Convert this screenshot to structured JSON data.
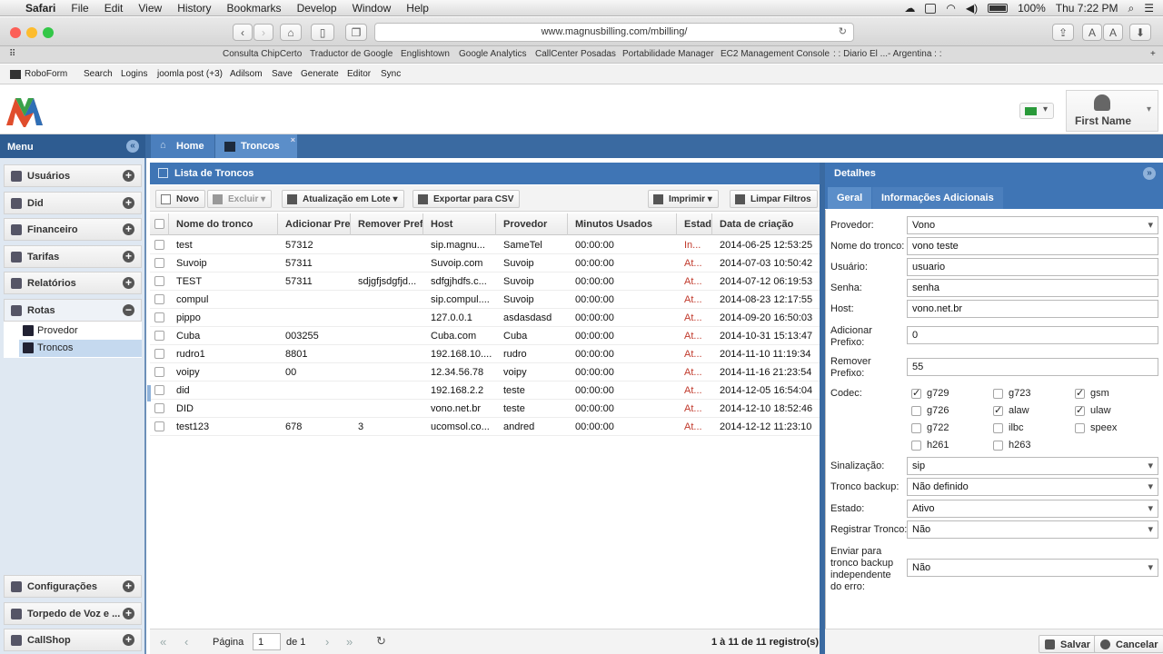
{
  "menubar": {
    "items": [
      "Safari",
      "File",
      "Edit",
      "View",
      "History",
      "Bookmarks",
      "Develop",
      "Window",
      "Help"
    ],
    "battery": "100%",
    "clock": "Thu 7:22 PM"
  },
  "browser": {
    "url": "www.magnusbilling.com/mbilling/",
    "bookmarks": [
      "Consulta ChipCerto",
      "Traductor de Google",
      "Englishtown",
      "Google Analytics",
      "CallCenter Posadas",
      "Portabilidade Manager",
      "EC2 Management Console",
      ": : Diario El ...- Argentina : :"
    ],
    "robobar": [
      "RoboForm",
      "Search",
      "Logins",
      "joomla post (+3)",
      "Adilsom",
      "Save",
      "Generate",
      "Editor",
      "Sync"
    ]
  },
  "header": {
    "user_name": "First Name"
  },
  "sidebar": {
    "title": "Menu",
    "items": [
      "Usuários",
      "Did",
      "Financeiro",
      "Tarifas",
      "Relatórios",
      "Rotas"
    ],
    "subitems": [
      "Provedor",
      "Troncos"
    ],
    "bottom_items": [
      "Configurações",
      "Torpedo de Voz e ...",
      "CallShop"
    ]
  },
  "tabs": {
    "home": "Home",
    "troncos": "Troncos"
  },
  "grid": {
    "title": "Lista de Troncos",
    "toolbar": {
      "new": "Novo",
      "delete": "Excluir",
      "batch": "Atualização em Lote",
      "export": "Exportar para CSV",
      "print": "Imprimir",
      "clear": "Limpar Filtros"
    },
    "columns": [
      "Nome do tronco",
      "Adicionar Prefi",
      "Remover Prefi",
      "Host",
      "Provedor",
      "Minutos Usados",
      "Estado",
      "Data de criação"
    ],
    "rows": [
      [
        "test",
        "57312",
        "",
        "sip.magnu...",
        "SameTel",
        "00:00:00",
        "In...",
        "2014-06-25 12:53:25"
      ],
      [
        "Suvoip",
        "57311",
        "",
        "Suvoip.com",
        "Suvoip",
        "00:00:00",
        "At...",
        "2014-07-03 10:50:42"
      ],
      [
        "TEST",
        "57311",
        "sdjgfjsdgfjd...",
        "sdfgjhdfs.c...",
        "Suvoip",
        "00:00:00",
        "At...",
        "2014-07-12 06:19:53"
      ],
      [
        "compul",
        "",
        "",
        "sip.compul....",
        "Suvoip",
        "00:00:00",
        "At...",
        "2014-08-23 12:17:55"
      ],
      [
        "pippo",
        "",
        "",
        "127.0.0.1",
        "asdasdasd",
        "00:00:00",
        "At...",
        "2014-09-20 16:50:03"
      ],
      [
        "Cuba",
        "003255",
        "",
        "Cuba.com",
        "Cuba",
        "00:00:00",
        "At...",
        "2014-10-31 15:13:47"
      ],
      [
        "rudro1",
        "8801",
        "",
        "192.168.10....",
        "rudro",
        "00:00:00",
        "At...",
        "2014-11-10 11:19:34"
      ],
      [
        "voipy",
        "00",
        "",
        "12.34.56.78",
        "voipy",
        "00:00:00",
        "At...",
        "2014-11-16 21:23:54"
      ],
      [
        "did",
        "",
        "",
        "192.168.2.2",
        "teste",
        "00:00:00",
        "At...",
        "2014-12-05 16:54:04"
      ],
      [
        "DID",
        "",
        "",
        "vono.net.br",
        "teste",
        "00:00:00",
        "At...",
        "2014-12-10 18:52:46"
      ],
      [
        "test123",
        "678",
        "3",
        "ucomsol.co...",
        "andred",
        "00:00:00",
        "At...",
        "2014-12-12 11:23:10"
      ]
    ],
    "pager": {
      "page_label": "Página",
      "page": "1",
      "of": "de 1",
      "summary": "1 à 11 de 11 registro(s)"
    }
  },
  "details": {
    "title": "Detalhes",
    "tabs": [
      "Geral",
      "Informações Adicionais"
    ],
    "labels": {
      "provedor": "Provedor:",
      "nome": "Nome do tronco:",
      "usuario": "Usuário:",
      "senha": "Senha:",
      "host": "Host:",
      "add1": "Adicionar",
      "add2": "Prefixo:",
      "rem1": "Remover",
      "rem2": "Prefixo:",
      "codec": "Codec:",
      "sinal": "Sinalização:",
      "backup": "Tronco backup:",
      "estado": "Estado:",
      "registrar": "Registrar Tronco:",
      "enviar": "Enviar para tronco backup independente do erro:"
    },
    "values": {
      "provedor": "Vono",
      "nome": "vono teste",
      "usuario": "usuario",
      "senha": "senha",
      "host": "vono.net.br",
      "add": "0",
      "rem": "55",
      "sinal": "sip",
      "backup": "Não definido",
      "estado": "Ativo",
      "registrar": "Não",
      "enviar": "Não"
    },
    "codecs": [
      {
        "name": "g729",
        "checked": true
      },
      {
        "name": "g723",
        "checked": false
      },
      {
        "name": "gsm",
        "checked": true
      },
      {
        "name": "g726",
        "checked": false
      },
      {
        "name": "alaw",
        "checked": true
      },
      {
        "name": "ulaw",
        "checked": true
      },
      {
        "name": "g722",
        "checked": false
      },
      {
        "name": "ilbc",
        "checked": false
      },
      {
        "name": "speex",
        "checked": false
      },
      {
        "name": "h261",
        "checked": false
      },
      {
        "name": "h263",
        "checked": false
      }
    ],
    "buttons": {
      "save": "Salvar",
      "cancel": "Cancelar"
    }
  },
  "colors": {
    "band": "#3a6aa1",
    "panel_header": "#3f75b5",
    "sidebar_bg": "#dfe8f2",
    "status_inactive": "#c0392b"
  }
}
